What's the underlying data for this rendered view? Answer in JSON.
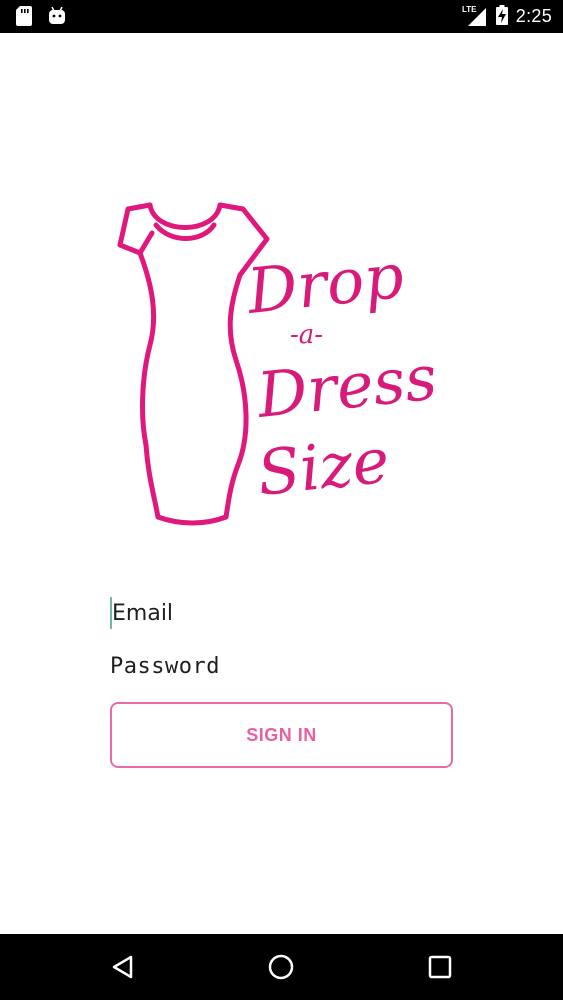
{
  "status_bar": {
    "time": "2:25",
    "network": "LTE",
    "icons": [
      "sd-card-icon",
      "android-icon",
      "lte-signal-icon",
      "battery-charging-icon"
    ]
  },
  "logo": {
    "line1": "Drop",
    "line2": "-a-",
    "line3": "Dress",
    "line4": "Size",
    "brand_color": "#d81b7a"
  },
  "login": {
    "email_placeholder": "Email",
    "password_placeholder": "Password",
    "sign_in_label": "SIGN IN",
    "accent_color": "#e86aa6"
  },
  "nav_bar": {
    "icons": [
      "back-icon",
      "home-icon",
      "recents-icon"
    ]
  }
}
